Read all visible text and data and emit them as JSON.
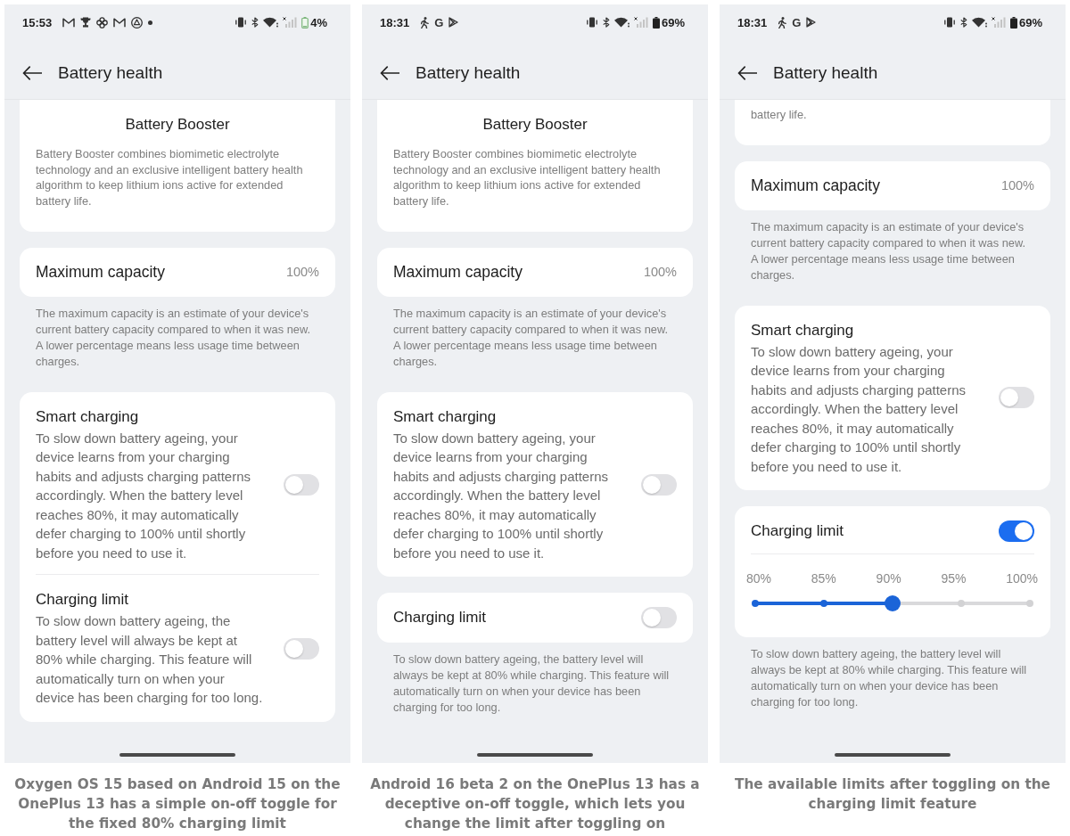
{
  "panels": [
    {
      "status_bar": {
        "time": "15:53",
        "notifications": [
          {
            "kind": "mail"
          },
          {
            "kind": "trophy"
          },
          {
            "kind": "fan"
          },
          {
            "kind": "mail"
          },
          {
            "kind": "drive"
          },
          {
            "kind": "dot"
          }
        ],
        "battery": {
          "kind": "low",
          "reading": "4%"
        }
      },
      "header": {
        "title": "Battery health"
      },
      "sections": [
        {
          "kind": "card",
          "items": [
            {
              "kind": "intro",
              "title": "Battery Booster",
              "body": "Battery Booster combines biomimetic electrolyte technology and an exclusive intelligent battery health algorithm to keep lithium ions active for extended battery life."
            }
          ]
        },
        {
          "kind": "card",
          "items": [
            {
              "kind": "value",
              "label": "Maximum capacity",
              "value": "100%"
            }
          ]
        },
        {
          "kind": "note",
          "text": "The maximum capacity is an estimate of your device's current battery capacity compared to when it was new. A lower percentage means less usage time between charges."
        },
        {
          "kind": "card",
          "items": [
            {
              "kind": "toggle",
              "title": "Smart charging",
              "body": "To slow down battery ageing, your device learns from your charging habits and adjusts charging patterns accordingly. When the battery level reaches 80%, it may automatically defer charging to 100% until shortly before you need to use it.",
              "on": false
            },
            {
              "kind": "toggle",
              "title": "Charging limit",
              "body": "To slow down battery ageing, the battery level will always be kept at 80% while charging. This feature will automatically turn on when your device has been charging for too long.",
              "on": false
            }
          ]
        }
      ]
    },
    {
      "status_bar": {
        "time": "18:31",
        "notifications": [
          {
            "kind": "walk"
          },
          {
            "kind": "glyph",
            "text": "G"
          },
          {
            "kind": "play"
          }
        ],
        "battery": {
          "kind": "full",
          "reading": "69%"
        }
      },
      "header": {
        "title": "Battery health"
      },
      "sections": [
        {
          "kind": "card",
          "items": [
            {
              "kind": "intro",
              "title": "Battery Booster",
              "body": "Battery Booster combines biomimetic electrolyte technology and an exclusive intelligent battery health algorithm to keep lithium ions active for extended battery life."
            }
          ]
        },
        {
          "kind": "card",
          "items": [
            {
              "kind": "value",
              "label": "Maximum capacity",
              "value": "100%"
            }
          ]
        },
        {
          "kind": "note",
          "text": "The maximum capacity is an estimate of your device's current battery capacity compared to when it was new. A lower percentage means less usage time between charges."
        },
        {
          "kind": "card",
          "items": [
            {
              "kind": "toggle",
              "title": "Smart charging",
              "body": "To slow down battery ageing, your device learns from your charging habits and adjusts charging patterns accordingly. When the battery level reaches 80%, it may automatically defer charging to 100% until shortly before you need to use it.",
              "on": false
            }
          ]
        },
        {
          "kind": "card",
          "items": [
            {
              "kind": "toggle",
              "title": "Charging limit",
              "on": false
            }
          ]
        },
        {
          "kind": "note",
          "text": "To slow down battery ageing, the battery level will always be kept at 80% while charging. This feature will automatically turn on when your device has been charging for too long."
        }
      ]
    },
    {
      "status_bar": {
        "time": "18:31",
        "notifications": [
          {
            "kind": "walk"
          },
          {
            "kind": "glyph",
            "text": "G"
          },
          {
            "kind": "play"
          }
        ],
        "battery": {
          "kind": "full",
          "reading": "69%"
        }
      },
      "header": {
        "title": "Battery health"
      },
      "sections": [
        {
          "kind": "card",
          "items": [
            {
              "kind": "intro",
              "body": "battery life."
            }
          ]
        },
        {
          "kind": "card",
          "items": [
            {
              "kind": "value",
              "label": "Maximum capacity",
              "value": "100%"
            }
          ]
        },
        {
          "kind": "note",
          "text": "The maximum capacity is an estimate of your device's current battery capacity compared to when it was new. A lower percentage means less usage time between charges."
        },
        {
          "kind": "card",
          "items": [
            {
              "kind": "toggle",
              "title": "Smart charging",
              "body": "To slow down battery ageing, your device learns from your charging habits and adjusts charging patterns accordingly. When the battery level reaches 80%, it may automatically defer charging to 100% until shortly before you need to use it.",
              "on": false
            }
          ]
        },
        {
          "kind": "card",
          "items": [
            {
              "kind": "toggle",
              "title": "Charging limit",
              "on": true
            },
            {
              "kind": "slider",
              "stops": [
                "80%",
                "85%",
                "90%",
                "95%",
                "100%"
              ],
              "level": 0.5
            }
          ]
        },
        {
          "kind": "note",
          "text": "To slow down battery ageing, the battery level will always be kept at 80% while charging. This feature will automatically turn on when your device has been charging for too long."
        }
      ]
    }
  ],
  "captions": [
    "Oxygen OS 15 based on Android 15 on the OnePlus 13 has a simple on-off toggle for the fixed 80% charging limit",
    "Android 16 beta 2 on the OnePlus 13 has a deceptive on-off toggle, which lets you change the limit after toggling on",
    "The available limits after toggling on the charging limit feature"
  ]
}
